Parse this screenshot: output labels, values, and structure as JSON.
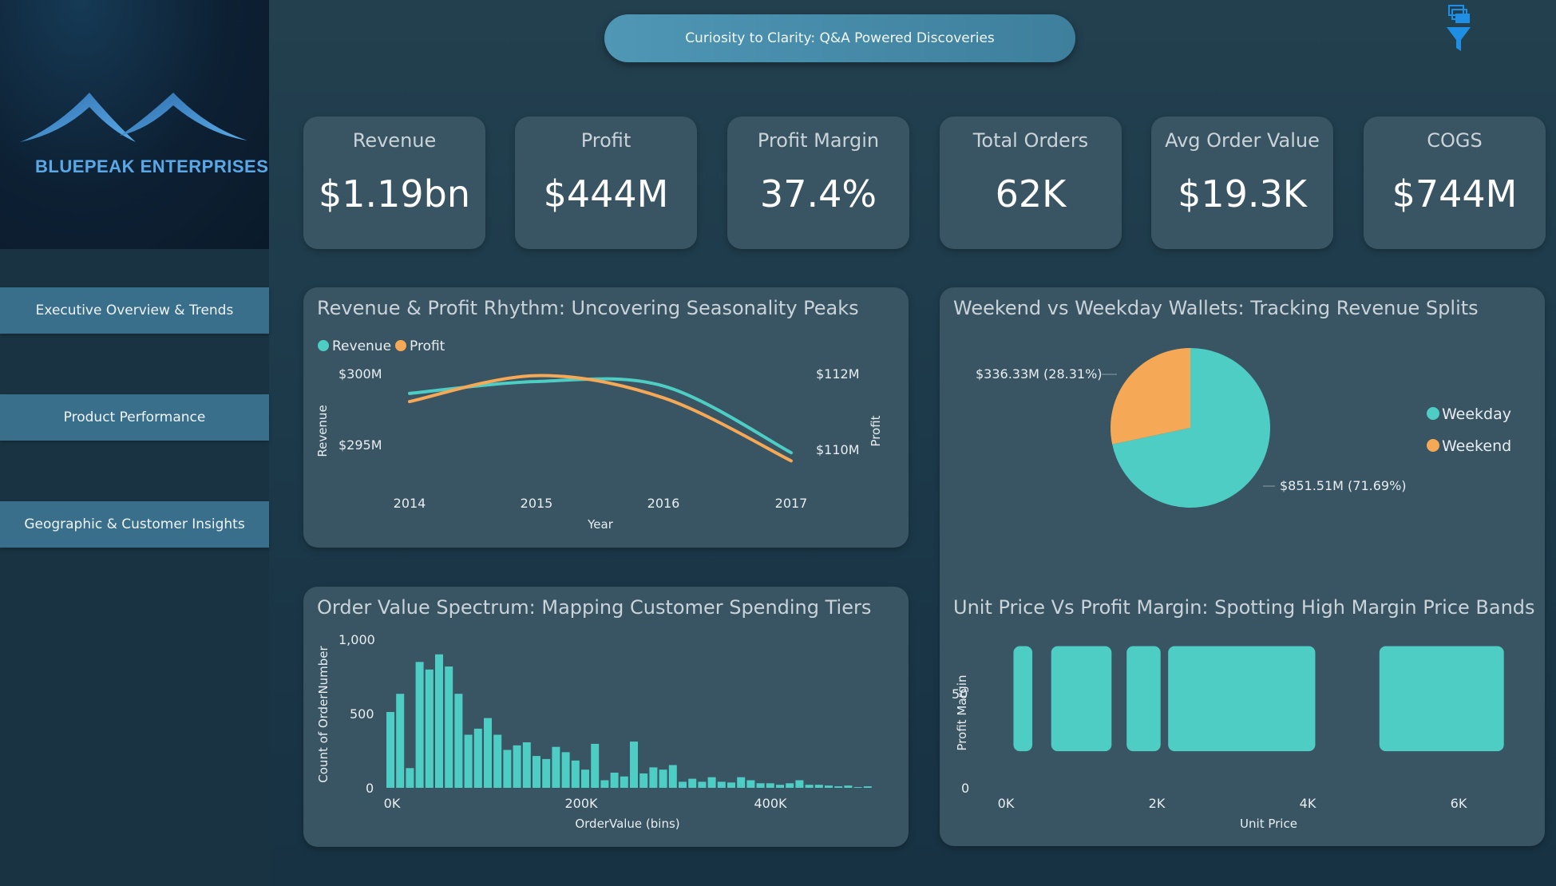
{
  "header": {
    "title": "Curiosity to Clarity: Q&A Powered Discoveries"
  },
  "brand": {
    "name": "BLUEPEAK ENTERPRISES"
  },
  "nav": [
    {
      "label": "Executive Overview & Trends"
    },
    {
      "label": "Product Performance"
    },
    {
      "label": "Geographic & Customer Insights"
    }
  ],
  "kpis": [
    {
      "label": "Revenue",
      "value": "$1.19bn"
    },
    {
      "label": "Profit",
      "value": "$444M"
    },
    {
      "label": "Profit Margin",
      "value": "37.4%"
    },
    {
      "label": "Total Orders",
      "value": "62K"
    },
    {
      "label": "Avg Order Value",
      "value": "$19.3K"
    },
    {
      "label": "COGS",
      "value": "$744M"
    }
  ],
  "colors": {
    "teal": "#4ecdc4",
    "orange": "#f5a855",
    "card": "#395462"
  },
  "charts": {
    "line": {
      "title": "Revenue & Profit Rhythm: Uncovering Seasonality Peaks",
      "legend": [
        "Revenue",
        "Profit"
      ],
      "y_left_ticks": [
        "$300M",
        "$295M"
      ],
      "y_right_ticks": [
        "$112M",
        "$110M"
      ],
      "x_ticks": [
        "2014",
        "2015",
        "2016",
        "2017"
      ],
      "xlabel": "Year",
      "ylabel_left": "Revenue",
      "ylabel_right": "Profit"
    },
    "pie": {
      "title": "Weekend vs Weekday Wallets: Tracking Revenue Splits",
      "legend": [
        "Weekday",
        "Weekend"
      ],
      "label_weekend": "$336.33M (28.31%)",
      "label_weekday": "$851.51M (71.69%)"
    },
    "hist": {
      "title": "Order Value Spectrum: Mapping Customer Spending Tiers",
      "y_ticks": [
        "1,000",
        "500",
        "0"
      ],
      "x_ticks": [
        "0K",
        "200K",
        "400K"
      ],
      "xlabel": "OrderValue (bins)",
      "ylabel": "Count of OrderNumber"
    },
    "scatter": {
      "title": "Unit Price Vs Profit Margin: Spotting High Margin Price Bands",
      "y_ticks": [
        "50",
        "0"
      ],
      "x_ticks": [
        "0K",
        "2K",
        "4K",
        "6K"
      ],
      "xlabel": "Unit Price",
      "ylabel": "Profit Margin"
    }
  },
  "chart_data": [
    {
      "type": "line",
      "title": "Revenue & Profit Rhythm: Uncovering Seasonality Peaks",
      "categories": [
        "2014",
        "2015",
        "2016",
        "2017"
      ],
      "series": [
        {
          "name": "Revenue",
          "axis": "left",
          "values": [
            298.8,
            299.6,
            299.3,
            294.8
          ]
        },
        {
          "name": "Profit",
          "axis": "right",
          "values": [
            111.2,
            111.9,
            111.3,
            109.6
          ]
        }
      ],
      "ylim_left": [
        294,
        301
      ],
      "ylim_right": [
        109.5,
        112.3
      ],
      "xlabel": "Year",
      "ylabel": "Revenue",
      "y2label": "Profit"
    },
    {
      "type": "pie",
      "title": "Weekend vs Weekday Wallets: Tracking Revenue Splits",
      "slices": [
        {
          "name": "Weekday",
          "value": 851.51,
          "pct": 71.69
        },
        {
          "name": "Weekend",
          "value": 336.33,
          "pct": 28.31
        }
      ]
    },
    {
      "type": "bar",
      "title": "Order Value Spectrum: Mapping Customer Spending Tiers",
      "xlabel": "OrderValue (bins)",
      "ylabel": "Count of OrderNumber",
      "ylim": [
        0,
        1000
      ],
      "xlim": [
        0,
        480
      ],
      "bin_width_k": 9.6,
      "values": [
        500,
        620,
        130,
        830,
        780,
        880,
        800,
        620,
        350,
        390,
        460,
        350,
        250,
        280,
        300,
        210,
        190,
        270,
        235,
        180,
        120,
        290,
        50,
        100,
        75,
        305,
        95,
        135,
        120,
        150,
        40,
        60,
        40,
        70,
        40,
        35,
        70,
        50,
        30,
        30,
        20,
        30,
        50,
        20,
        20,
        15,
        10,
        15,
        5,
        10
      ]
    },
    {
      "type": "scatter",
      "title": "Unit Price Vs Profit Margin: Spotting High Margin Price Bands",
      "xlabel": "Unit Price",
      "ylabel": "Profit Margin",
      "xlim": [
        0,
        6800
      ],
      "ylim": [
        0,
        60
      ],
      "bands": [
        {
          "x0": 100,
          "x1": 350,
          "y0": 15,
          "y1": 58
        },
        {
          "x0": 600,
          "x1": 1400,
          "y0": 15,
          "y1": 58
        },
        {
          "x0": 1600,
          "x1": 2050,
          "y0": 15,
          "y1": 58
        },
        {
          "x0": 2150,
          "x1": 4100,
          "y0": 15,
          "y1": 58
        },
        {
          "x0": 4950,
          "x1": 6600,
          "y0": 15,
          "y1": 58
        }
      ]
    }
  ]
}
